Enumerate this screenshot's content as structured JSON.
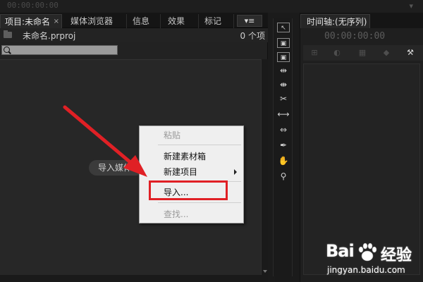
{
  "top": {
    "timecode": "00:00:00:00"
  },
  "project": {
    "tabs": [
      {
        "label": "项目:未命名",
        "active": true
      },
      {
        "label": "媒体浏览器"
      },
      {
        "label": "信息"
      },
      {
        "label": "效果"
      },
      {
        "label": "标记"
      }
    ],
    "close_glyph": "×",
    "menu_glyph": "▾≡",
    "file_name": "未命名.prproj",
    "item_count": "0 个项",
    "import_hint": "导入媒体以开始"
  },
  "context_menu": {
    "items": [
      {
        "label": "粘贴",
        "disabled": true
      },
      {
        "label": "新建素材箱",
        "disabled": false
      },
      {
        "label": "新建项目",
        "disabled": false,
        "submenu": true
      },
      {
        "label": "导入...",
        "disabled": false,
        "highlighted": true
      },
      {
        "label": "查找...",
        "disabled": true
      }
    ]
  },
  "tools": [
    {
      "name": "selection-tool",
      "glyph": "↖"
    },
    {
      "name": "track-select-tool",
      "glyph": "▣"
    },
    {
      "name": "ripple-edit-tool",
      "glyph": "▣"
    },
    {
      "name": "rolling-edit-tool",
      "glyph": "⇹"
    },
    {
      "name": "rate-stretch-tool",
      "glyph": "⇼"
    },
    {
      "name": "razor-tool",
      "glyph": "✂"
    },
    {
      "name": "slip-tool",
      "glyph": "⟷"
    },
    {
      "name": "slide-tool",
      "glyph": "⇔"
    },
    {
      "name": "pen-tool",
      "glyph": "✒"
    },
    {
      "name": "hand-tool",
      "glyph": "✋"
    },
    {
      "name": "zoom-tool",
      "glyph": "⚲"
    }
  ],
  "timeline": {
    "tab_label": "时间轴:(无序列)",
    "timecode": "00:00:00:00"
  },
  "watermark": {
    "logo": "Bai",
    "brand_cn": "经验",
    "url": "jingyan.baidu.com"
  },
  "colors": {
    "highlight_border": "#e02025",
    "annotation_arrow": "#e02025",
    "menu_background": "#efefef"
  }
}
